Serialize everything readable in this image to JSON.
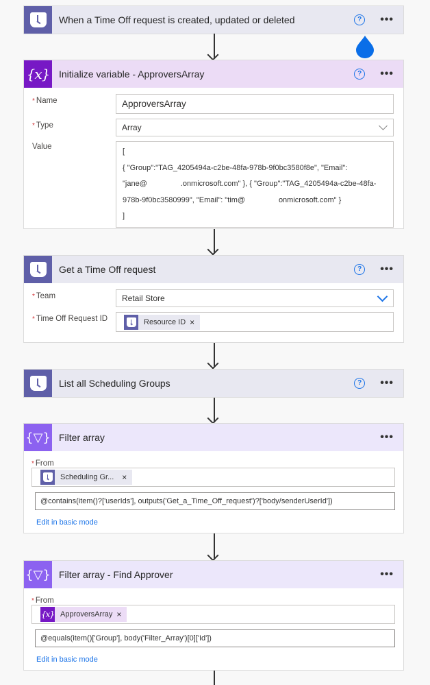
{
  "steps": {
    "trigger": {
      "title": "When a Time Off request is created, updated or deleted",
      "icon": "teams-shifts-icon",
      "help_label": "?",
      "more_label": "•••"
    },
    "init_var": {
      "title": "Initialize variable - ApproversArray",
      "icon": "variable-icon",
      "help_label": "?",
      "more_label": "•••",
      "name_label": "Name",
      "name_value": "ApproversArray",
      "type_label": "Type",
      "type_value": "Array",
      "value_label": "Value",
      "value_lines": [
        "[",
        "{ \"Group\":\"TAG_4205494a-c2be-48fa-978b-9f0bc3580f8e\", \"Email\":",
        "\"jane@                .onmicrosoft.com\" }, { \"Group\":\"TAG_4205494a-c2be-48fa-",
        "978b-9f0bc3580999\", \"Email\": \"tim@                onmicrosoft.com\" }",
        "]"
      ],
      "required_mark": "*"
    },
    "get_time_off": {
      "title": "Get a Time Off request",
      "icon": "teams-shifts-icon",
      "help_label": "?",
      "more_label": "•••",
      "team_label": "Team",
      "team_value": "Retail Store",
      "request_id_label": "Time Off Request ID",
      "request_id_token": "Resource ID",
      "token_remove": "×",
      "required_mark": "*"
    },
    "list_groups": {
      "title": "List all Scheduling Groups",
      "icon": "teams-shifts-icon",
      "help_label": "?",
      "more_label": "•••"
    },
    "filter_array": {
      "title": "Filter array",
      "icon": "filter-array-icon",
      "more_label": "•••",
      "from_label": "From",
      "from_token": "Scheduling Gr...",
      "token_remove": "×",
      "expression": "@contains(item()?['userIds'], outputs('Get_a_Time_Off_request')?['body/senderUserId'])",
      "edit_link": "Edit in basic mode",
      "required_mark": "*"
    },
    "filter_find_approver": {
      "title": "Filter array - Find Approver",
      "icon": "filter-array-icon",
      "more_label": "•••",
      "from_label": "From",
      "from_token": "ApproversArray",
      "token_remove": "×",
      "expression": "@equals(item()['Group'], body('Filter_Array')[0]['Id'])",
      "edit_link": "Edit in basic mode",
      "required_mark": "*"
    }
  },
  "glyphs": {
    "variable": "{x}",
    "filter": "{▽}"
  },
  "colors": {
    "teams_icon_bg": "#5f5fa8",
    "variable_icon_bg": "#7718c5",
    "filter_icon_bg": "#8c62f0",
    "link": "#1a73e8",
    "required": "#d13438"
  }
}
